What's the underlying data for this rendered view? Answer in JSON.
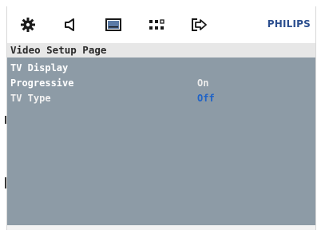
{
  "brand": "PHILIPS",
  "toolbar": {
    "icons": [
      {
        "name": "general-setup-icon"
      },
      {
        "name": "audio-setup-icon"
      },
      {
        "name": "video-setup-icon"
      },
      {
        "name": "preference-icon"
      },
      {
        "name": "exit-icon"
      }
    ]
  },
  "page_title": "Video Setup Page",
  "menu": {
    "items": [
      {
        "label": "TV Display",
        "value": ""
      },
      {
        "label": "Progressive",
        "value": "On"
      },
      {
        "label": "TV Type",
        "value": "Off"
      }
    ]
  },
  "colors": {
    "panel": "#8d9ba6",
    "value_default": "#e8e8e8",
    "value_highlight": "#1f63c7",
    "brand": "#2c4f8f"
  }
}
